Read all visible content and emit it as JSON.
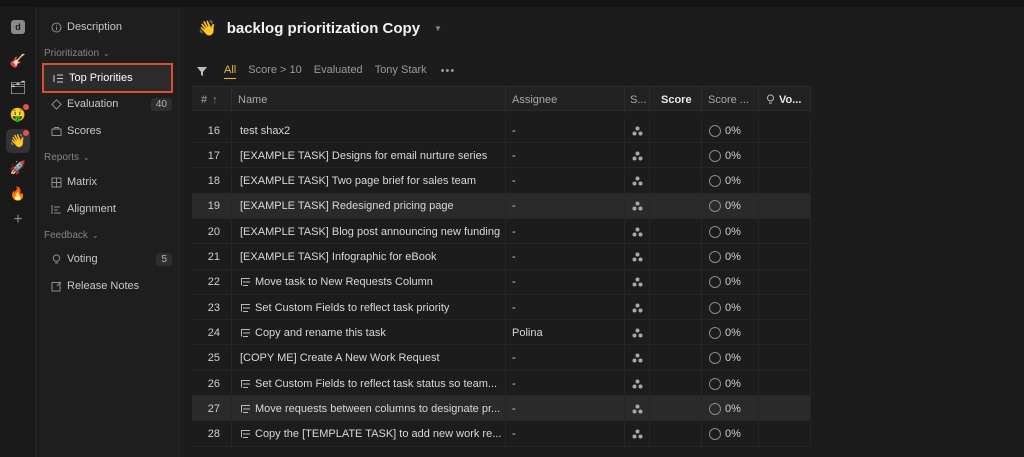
{
  "app": {
    "rail": [
      {
        "name": "app-logo",
        "glyph": "d"
      },
      {
        "name": "guitar-emoji",
        "glyph": "🎸"
      },
      {
        "name": "grid-emoji",
        "glyph": "🗂"
      },
      {
        "name": "face-emoji",
        "glyph": "🤑"
      },
      {
        "name": "wave-emoji",
        "glyph": "👋"
      },
      {
        "name": "rocket-emoji",
        "glyph": "🚀"
      },
      {
        "name": "fire-emoji",
        "glyph": "🔥"
      },
      {
        "name": "plus-icon",
        "glyph": "+"
      }
    ]
  },
  "sidebar": {
    "description": "Description",
    "prioritization_label": "Prioritization",
    "top_priorities": "Top Priorities",
    "evaluation": "Evaluation",
    "evaluation_count": "40",
    "scores": "Scores",
    "reports_label": "Reports",
    "matrix": "Matrix",
    "alignment": "Alignment",
    "feedback_label": "Feedback",
    "voting": "Voting",
    "voting_count": "5",
    "release_notes": "Release Notes"
  },
  "header": {
    "emoji": "👋",
    "title": "backlog prioritization Copy"
  },
  "views": {
    "all": "All",
    "score_gt_10": "Score > 10",
    "evaluated": "Evaluated",
    "tony_stark": "Tony Stark",
    "more": "•••"
  },
  "table": {
    "headers": {
      "num": "#",
      "sort": "↑",
      "name": "Name",
      "assignee": "Assignee",
      "s": "S...",
      "score": "Score",
      "score_pct": "Score ...",
      "votes": "Vo..."
    },
    "rows": [
      {
        "num": "16",
        "name": "test shax2",
        "assignee": "-",
        "pct": "0%",
        "sub": false
      },
      {
        "num": "17",
        "name": "[EXAMPLE TASK] Designs for email nurture series",
        "assignee": "-",
        "pct": "0%",
        "sub": false
      },
      {
        "num": "18",
        "name": "[EXAMPLE TASK] Two page brief for sales team",
        "assignee": "-",
        "pct": "0%",
        "sub": false
      },
      {
        "num": "19",
        "name": "[EXAMPLE TASK] Redesigned pricing page",
        "assignee": "-",
        "pct": "0%",
        "sub": false
      },
      {
        "num": "20",
        "name": "[EXAMPLE TASK] Blog post announcing new funding",
        "assignee": "-",
        "pct": "0%",
        "sub": false
      },
      {
        "num": "21",
        "name": "[EXAMPLE TASK] Infographic for eBook",
        "assignee": "-",
        "pct": "0%",
        "sub": false
      },
      {
        "num": "22",
        "name": "Move task to New Requests Column",
        "assignee": "-",
        "pct": "0%",
        "sub": true
      },
      {
        "num": "23",
        "name": "Set Custom Fields to reflect task priority",
        "assignee": "-",
        "pct": "0%",
        "sub": true
      },
      {
        "num": "24",
        "name": "Copy and rename this task",
        "assignee": "Polina",
        "pct": "0%",
        "sub": true
      },
      {
        "num": "25",
        "name": "[COPY ME] Create A New Work Request",
        "assignee": "-",
        "pct": "0%",
        "sub": false
      },
      {
        "num": "26",
        "name": "Set Custom Fields to reflect task status so team...",
        "assignee": "-",
        "pct": "0%",
        "sub": true
      },
      {
        "num": "27",
        "name": "Move requests between columns to designate pr...",
        "assignee": "-",
        "pct": "0%",
        "sub": true
      },
      {
        "num": "28",
        "name": "Copy the [TEMPLATE TASK] to add new work re...",
        "assignee": "-",
        "pct": "0%",
        "sub": true
      }
    ]
  },
  "colors": {
    "accent": "#e8b936",
    "selection_border": "#d9502f",
    "notification": "#e2534a"
  }
}
